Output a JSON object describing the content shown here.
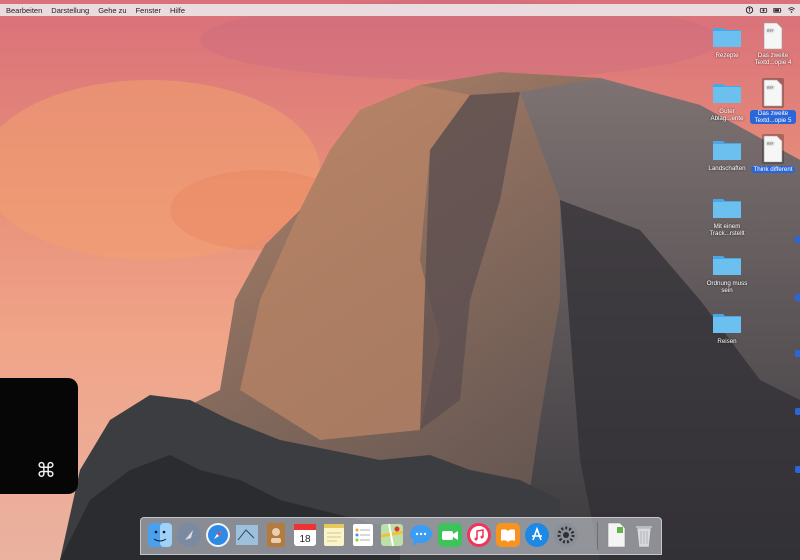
{
  "menubar": {
    "items": [
      "Bearbeiten",
      "Darstellung",
      "Gehe zu",
      "Fenster",
      "Hilfe"
    ],
    "status_icons": [
      "accessibility-icon",
      "camera-icon",
      "battery-icon",
      "wifi-icon"
    ]
  },
  "desktop": {
    "folders": [
      {
        "name": "Rezepte"
      },
      {
        "name": "Guter Ablag...ente"
      },
      {
        "name": "Landschaften"
      },
      {
        "name": "Mit einem Track...rstellt"
      },
      {
        "name": "Ordnung muss sein"
      },
      {
        "name": "Reisen"
      }
    ],
    "documents": [
      {
        "type_label": "RTF",
        "name": "Das zweite Textd...opie 4",
        "selected": false
      },
      {
        "type_label": "RTF",
        "name": "Das zweite Textd...opie 5",
        "selected": true
      },
      {
        "type_label": "RTF",
        "name": "Think different",
        "selected": true
      }
    ]
  },
  "hud": {
    "symbol": "⌘"
  },
  "dock": {
    "apps": [
      "finder-icon",
      "launchpad-icon",
      "safari-icon",
      "mail-icon",
      "contacts-icon",
      "calendar-icon",
      "notes-icon",
      "reminders-icon",
      "maps-icon",
      "messages-icon",
      "facetime-icon",
      "itunes-icon",
      "ibooks-icon",
      "app-store-icon",
      "system-preferences-icon"
    ],
    "calendar_day": "18",
    "extras": [
      "document-icon",
      "trash-icon"
    ]
  },
  "colors": {
    "selection": "#2a66d9",
    "folder": "#5ab3ea"
  }
}
